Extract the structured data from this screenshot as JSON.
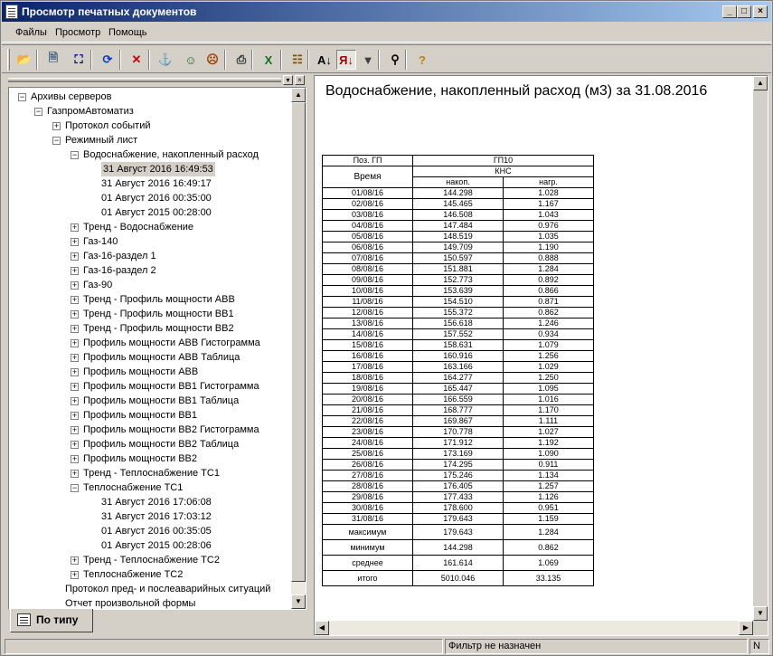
{
  "window": {
    "title": "Просмотр печатных документов",
    "min": "_",
    "max": "□",
    "close": "×"
  },
  "menu": [
    {
      "label": "Файлы"
    },
    {
      "label": "Просмотр"
    },
    {
      "label": "Помощь"
    }
  ],
  "toolbar": {
    "buttons": [
      {
        "name": "open-icon",
        "glyph": "📂",
        "color": "#c08000"
      },
      {
        "name": "print-preview-icon",
        "glyph": "🗎",
        "color": "#406080"
      },
      {
        "name": "select-area-icon",
        "glyph": "⛶",
        "color": "#000080"
      },
      {
        "name": "refresh-icon",
        "glyph": "⟳",
        "color": "#1040c0"
      },
      {
        "name": "delete-icon",
        "glyph": "✕",
        "color": "#d00000"
      },
      {
        "name": "connect-icon",
        "glyph": "⚓",
        "color": "#2040a0"
      },
      {
        "name": "user-add-icon",
        "glyph": "☺",
        "color": "#207020"
      },
      {
        "name": "user-remove-icon",
        "glyph": "☹",
        "color": "#a04000"
      },
      {
        "name": "print-icon",
        "glyph": "⎙",
        "color": "#303030"
      },
      {
        "name": "excel-icon",
        "glyph": "X",
        "color": "#107020"
      },
      {
        "name": "properties-icon",
        "glyph": "☷",
        "color": "#805000"
      },
      {
        "name": "sort-asc-icon",
        "glyph": "A↓",
        "color": "#000000"
      },
      {
        "name": "sort-desc-icon",
        "glyph": "Я↓",
        "color": "#a00000"
      },
      {
        "name": "filter-icon",
        "glyph": "▼",
        "color": "#404040"
      },
      {
        "name": "search-icon",
        "glyph": "⚲",
        "color": "#000000"
      },
      {
        "name": "help-icon",
        "glyph": "?",
        "color": "#c08000"
      }
    ]
  },
  "tree": {
    "nodes": [
      {
        "label": "Архивы серверов",
        "level": 0,
        "exp": "−"
      },
      {
        "label": "ГазпромАвтоматиз",
        "level": 1,
        "exp": "−"
      },
      {
        "label": "Протокол событий",
        "level": 2,
        "exp": "+"
      },
      {
        "label": "Режимный лист",
        "level": 2,
        "exp": "−"
      },
      {
        "label": "Водоснабжение, накопленный расход",
        "level": 3,
        "exp": "−"
      },
      {
        "label": "31 Август 2016 16:49:53",
        "level": 4,
        "exp": "",
        "selected": true
      },
      {
        "label": "31 Август 2016 16:49:17",
        "level": 4,
        "exp": ""
      },
      {
        "label": "01 Август 2016 00:35:00",
        "level": 4,
        "exp": ""
      },
      {
        "label": "01 Август 2015 00:28:00",
        "level": 4,
        "exp": ""
      },
      {
        "label": "Тренд - Водоснабжение",
        "level": 3,
        "exp": "+"
      },
      {
        "label": "Газ-140",
        "level": 3,
        "exp": "+"
      },
      {
        "label": "Газ-16-раздел 1",
        "level": 3,
        "exp": "+"
      },
      {
        "label": "Газ-16-раздел 2",
        "level": 3,
        "exp": "+"
      },
      {
        "label": "Газ-90",
        "level": 3,
        "exp": "+"
      },
      {
        "label": "Тренд - Профиль мощности АВВ",
        "level": 3,
        "exp": "+"
      },
      {
        "label": "Тренд - Профиль мощности ВВ1",
        "level": 3,
        "exp": "+"
      },
      {
        "label": "Тренд - Профиль мощности ВВ2",
        "level": 3,
        "exp": "+"
      },
      {
        "label": "Профиль мощности АВВ Гистограмма",
        "level": 3,
        "exp": "+"
      },
      {
        "label": "Профиль мощности АВВ Таблица",
        "level": 3,
        "exp": "+"
      },
      {
        "label": "Профиль мощности АВВ",
        "level": 3,
        "exp": "+"
      },
      {
        "label": "Профиль мощности ВВ1 Гистограмма",
        "level": 3,
        "exp": "+"
      },
      {
        "label": "Профиль мощности ВВ1 Таблица",
        "level": 3,
        "exp": "+"
      },
      {
        "label": "Профиль мощности ВВ1",
        "level": 3,
        "exp": "+"
      },
      {
        "label": "Профиль мощности ВВ2 Гистограмма",
        "level": 3,
        "exp": "+"
      },
      {
        "label": "Профиль мощности ВВ2 Таблица",
        "level": 3,
        "exp": "+"
      },
      {
        "label": "Профиль мощности ВВ2",
        "level": 3,
        "exp": "+"
      },
      {
        "label": "Тренд - Теплоснабжение ТС1",
        "level": 3,
        "exp": "+"
      },
      {
        "label": "Теплоснабжение ТС1",
        "level": 3,
        "exp": "−"
      },
      {
        "label": "31 Август 2016 17:06:08",
        "level": 4,
        "exp": ""
      },
      {
        "label": "31 Август 2016 17:03:12",
        "level": 4,
        "exp": ""
      },
      {
        "label": "01 Август 2016 00:35:05",
        "level": 4,
        "exp": ""
      },
      {
        "label": "01 Август 2015 00:28:06",
        "level": 4,
        "exp": ""
      },
      {
        "label": "Тренд - Теплоснабжение ТС2",
        "level": 3,
        "exp": "+"
      },
      {
        "label": "Теплоснабжение ТС2",
        "level": 3,
        "exp": "+"
      },
      {
        "label": "Протокол пред- и послеаварийных ситуаций",
        "level": 2,
        "exp": ""
      },
      {
        "label": "Отчет произвольной формы",
        "level": 2,
        "exp": ""
      }
    ]
  },
  "tab": {
    "label": "По типу"
  },
  "report": {
    "title": "Водоснабжение, накопленный расход (м3) за  31.08.2016",
    "h_pos": "Поз. ГП",
    "h_gp": "ГП10",
    "h_time": "Время",
    "h_kns": "КНС",
    "h_nakop": "накоп.",
    "h_nagr": "нагр.",
    "rows": [
      [
        "01/08/16",
        "144.298",
        "1.028"
      ],
      [
        "02/08/16",
        "145.465",
        "1.167"
      ],
      [
        "03/08/16",
        "146.508",
        "1.043"
      ],
      [
        "04/08/16",
        "147.484",
        "0.976"
      ],
      [
        "05/08/16",
        "148.519",
        "1.035"
      ],
      [
        "06/08/16",
        "149.709",
        "1.190"
      ],
      [
        "07/08/16",
        "150.597",
        "0.888"
      ],
      [
        "08/08/16",
        "151.881",
        "1.284"
      ],
      [
        "09/08/16",
        "152.773",
        "0.892"
      ],
      [
        "10/08/16",
        "153.639",
        "0.866"
      ],
      [
        "11/08/16",
        "154.510",
        "0.871"
      ],
      [
        "12/08/16",
        "155.372",
        "0.862"
      ],
      [
        "13/08/16",
        "156.618",
        "1.246"
      ],
      [
        "14/08/16",
        "157.552",
        "0.934"
      ],
      [
        "15/08/16",
        "158.631",
        "1.079"
      ],
      [
        "16/08/16",
        "160.916",
        "1.256"
      ],
      [
        "17/08/16",
        "163.166",
        "1.029"
      ],
      [
        "18/08/16",
        "164.277",
        "1.250"
      ],
      [
        "19/08/16",
        "165.447",
        "1.095"
      ],
      [
        "20/08/16",
        "166.559",
        "1.016"
      ],
      [
        "21/08/16",
        "168.777",
        "1.170"
      ],
      [
        "22/08/16",
        "169.867",
        "1.111"
      ],
      [
        "23/08/16",
        "170.778",
        "1.027"
      ],
      [
        "24/08/16",
        "171.912",
        "1.192"
      ],
      [
        "25/08/16",
        "173.169",
        "1.090"
      ],
      [
        "26/08/16",
        "174.295",
        "0.911"
      ],
      [
        "27/08/16",
        "175.246",
        "1.134"
      ],
      [
        "28/08/16",
        "176.405",
        "1.257"
      ],
      [
        "29/08/16",
        "177.433",
        "1.126"
      ],
      [
        "30/08/16",
        "178.600",
        "0.951"
      ],
      [
        "31/08/16",
        "179.643",
        "1.159"
      ]
    ],
    "summary": [
      [
        "максимум",
        "179.643",
        "1.284"
      ],
      [
        "минимум",
        "144.298",
        "0.862"
      ],
      [
        "среднее",
        "161.614",
        "1.069"
      ],
      [
        "итого",
        "5010.046",
        "33.135"
      ]
    ]
  },
  "status": {
    "filter": "Фильтр не назначен",
    "indicator": "N"
  }
}
